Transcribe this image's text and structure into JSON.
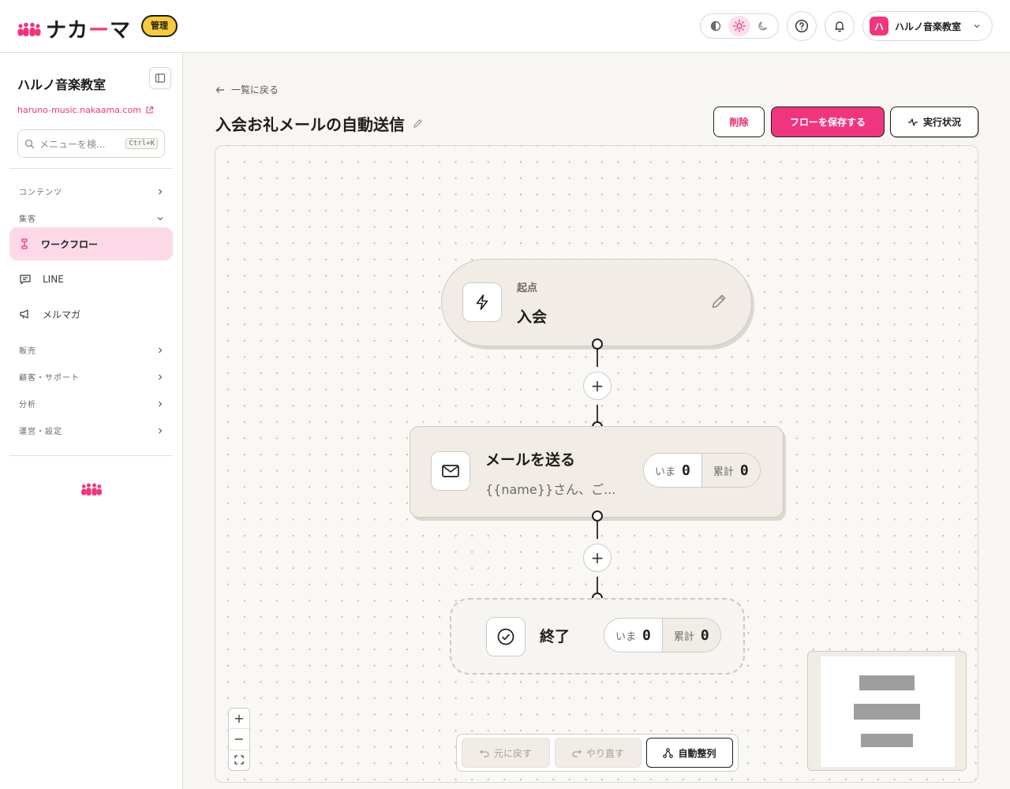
{
  "app": {
    "logo_text_a": "ナカ",
    "logo_text_b": "ー",
    "logo_text_c": "マ",
    "admin_badge": "管理",
    "brand_color": "#f0357f"
  },
  "header": {
    "theme_icons": [
      "contrast-icon",
      "sun-icon",
      "moon-icon"
    ],
    "active_theme": "light",
    "account": {
      "avatar": "ハ",
      "name": "ハルノ音楽教室"
    }
  },
  "sidebar": {
    "org_name": "ハルノ音楽教室",
    "org_url": "haruno-music.nakaama.com",
    "search_placeholder": "メニューを検...",
    "search_shortcut": "Ctrl+K",
    "sections": {
      "contents": "コンテンツ",
      "attract": "集客",
      "sales": "販売",
      "customer": "顧客・サポート",
      "analytics": "分析",
      "ops": "運営・設定"
    },
    "items": {
      "workflow": "ワークフロー",
      "line": "LINE",
      "newsletter": "メルマガ"
    }
  },
  "main": {
    "back_label": "一覧に戻る",
    "title": "入会お礼メールの自動送信",
    "buttons": {
      "delete": "削除",
      "save": "フローを保存する",
      "status": "実行状況"
    }
  },
  "flow": {
    "trigger": {
      "label": "起点",
      "value": "入会"
    },
    "mail": {
      "title": "メールを送る",
      "preview": "{{name}}さん、ご...",
      "now_label": "いま",
      "now_value": "0",
      "total_label": "累計",
      "total_value": "0"
    },
    "end": {
      "title": "終了",
      "now_label": "いま",
      "now_value": "0",
      "total_label": "累計",
      "total_value": "0"
    }
  },
  "controls": {
    "zoom_in": "+",
    "zoom_out": "−",
    "undo": "元に戻す",
    "redo": "やり直す",
    "auto_layout": "自動整列"
  }
}
